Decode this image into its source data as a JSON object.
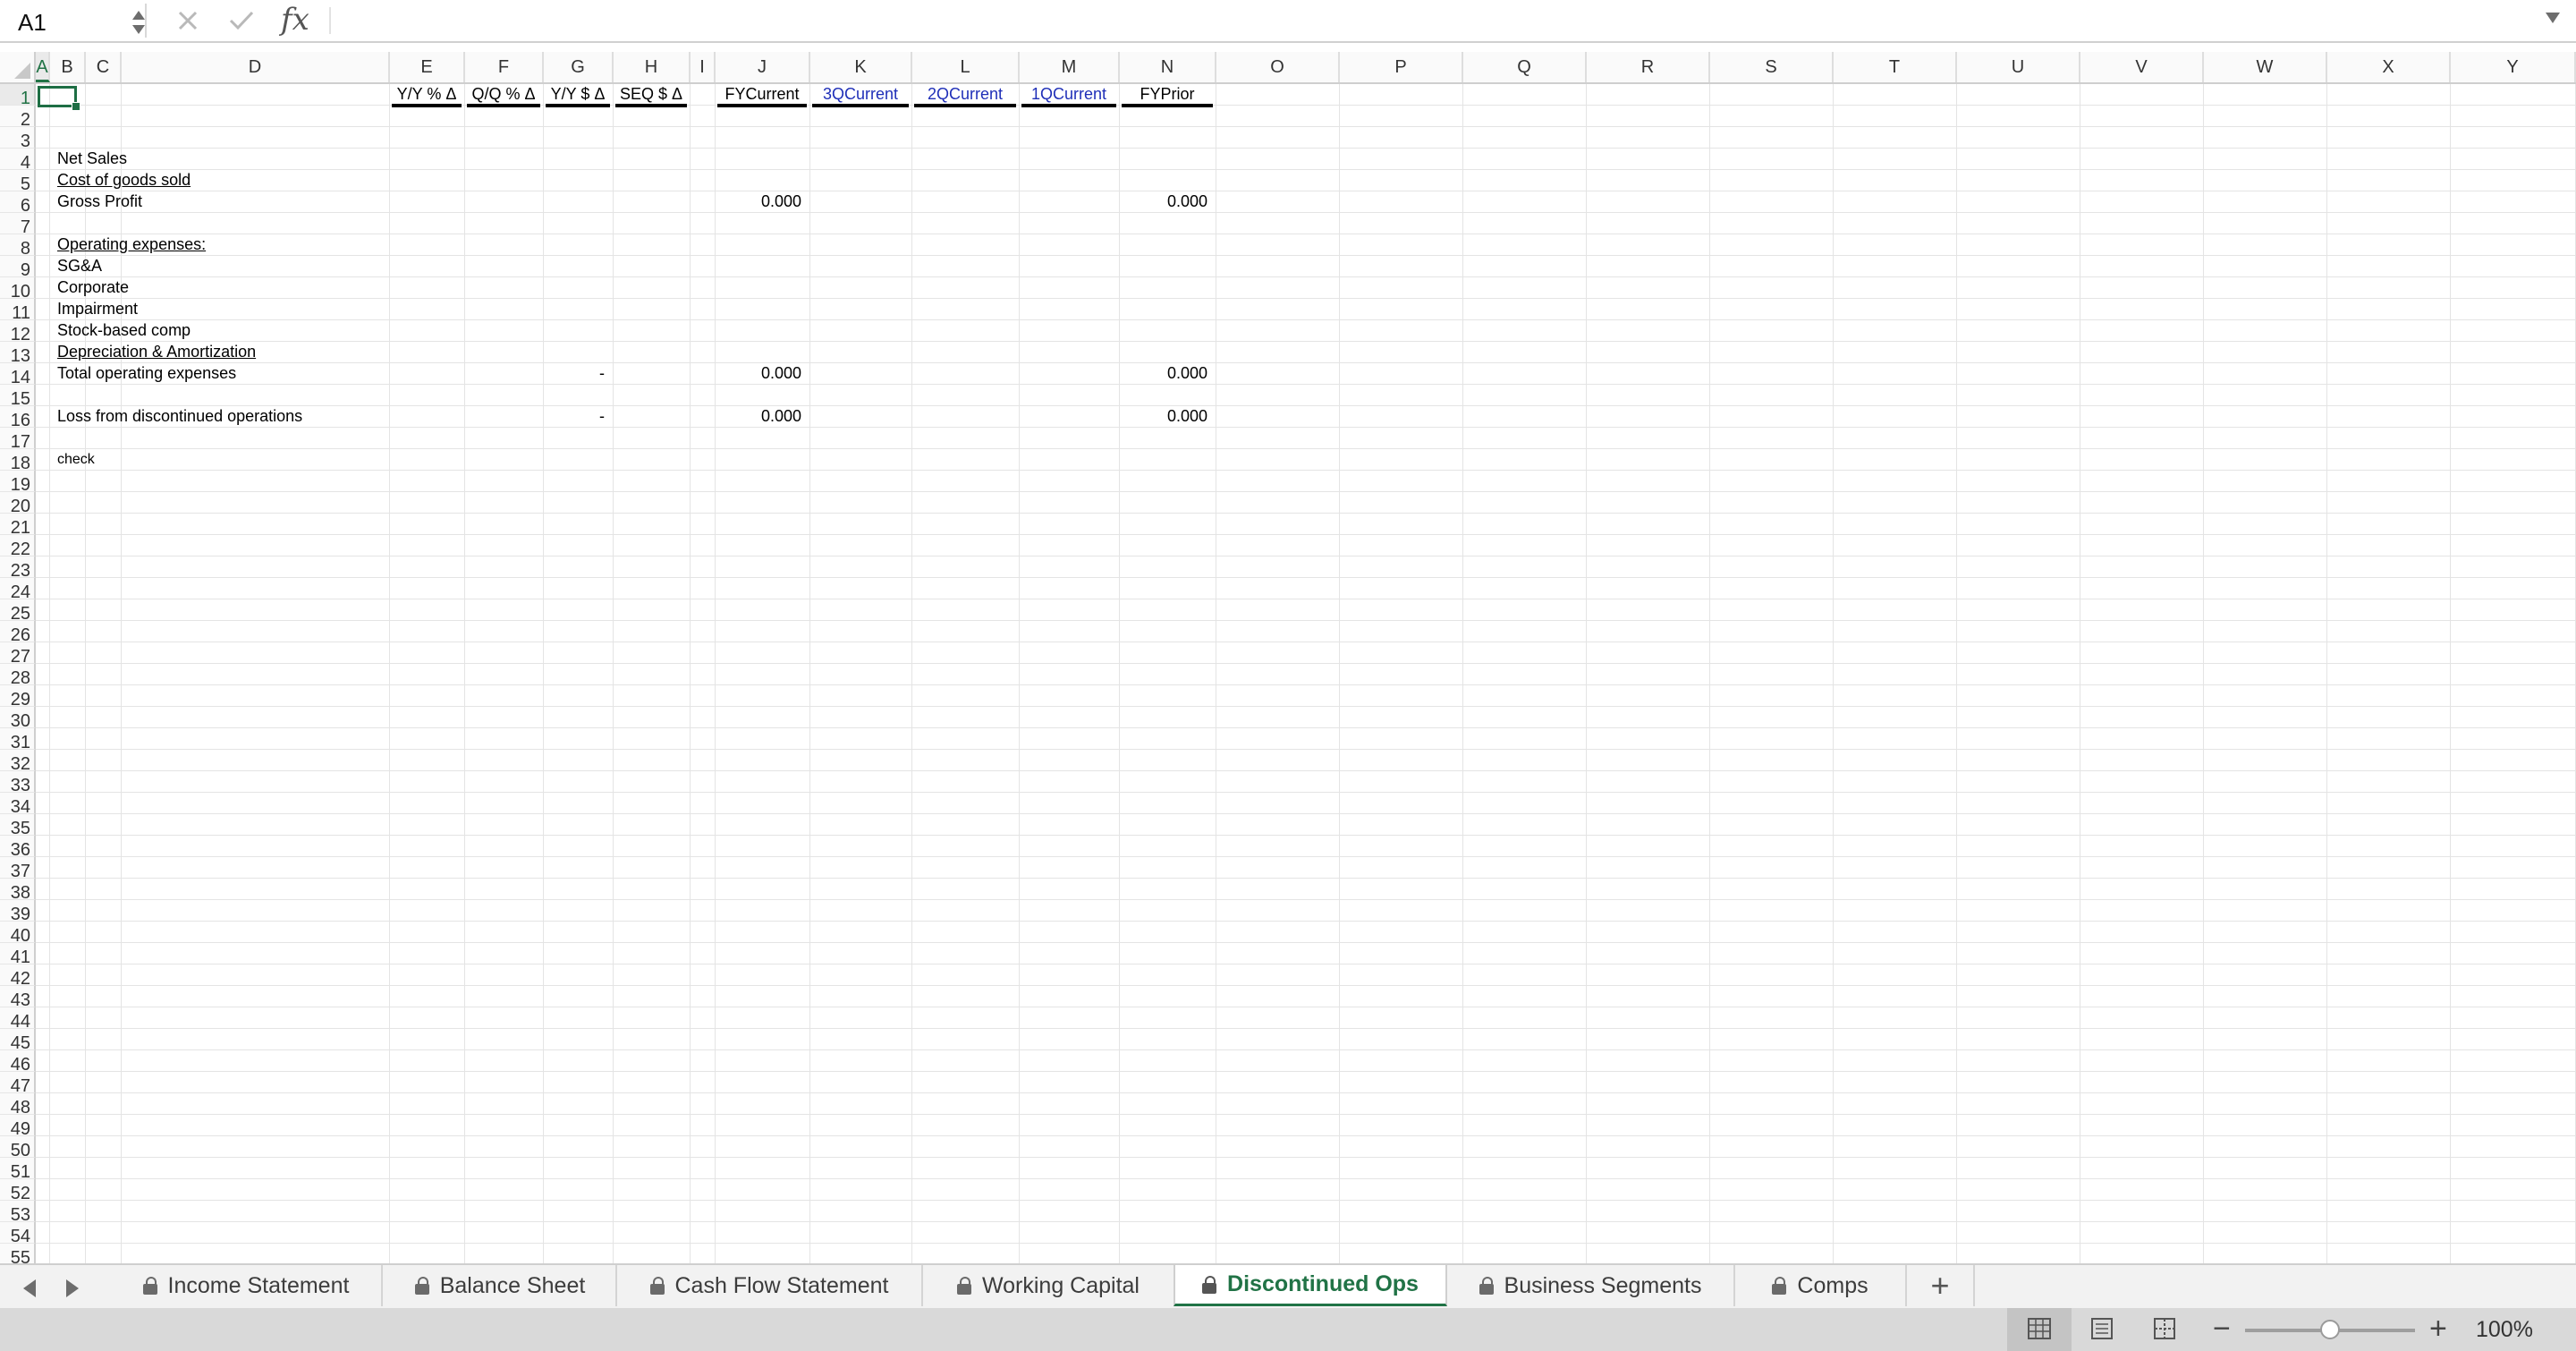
{
  "formula_bar": {
    "name_box": "A1",
    "fx_label": "fx",
    "formula": ""
  },
  "columns": [
    "A",
    "B",
    "C",
    "D",
    "E",
    "F",
    "G",
    "H",
    "I",
    "J",
    "K",
    "L",
    "M",
    "N",
    "O",
    "P",
    "Q",
    "R",
    "S",
    "T",
    "U",
    "V",
    "W",
    "X",
    "Y"
  ],
  "active_cell": {
    "column": "A",
    "row": 1
  },
  "row_count": 55,
  "cells": [
    {
      "ref": "E1",
      "text": "Y/Y % Δ",
      "style": "hdr"
    },
    {
      "ref": "F1",
      "text": "Q/Q % Δ",
      "style": "hdr"
    },
    {
      "ref": "G1",
      "text": "Y/Y $ Δ",
      "style": "hdr"
    },
    {
      "ref": "H1",
      "text": "SEQ $ Δ",
      "style": "hdr"
    },
    {
      "ref": "J1",
      "text": "FYCurrent",
      "style": "hdr"
    },
    {
      "ref": "K1",
      "text": "3QCurrent",
      "style": "hdr blue"
    },
    {
      "ref": "L1",
      "text": "2QCurrent",
      "style": "hdr blue"
    },
    {
      "ref": "M1",
      "text": "1QCurrent",
      "style": "hdr blue"
    },
    {
      "ref": "N1",
      "text": "FYPrior",
      "style": "hdr"
    },
    {
      "ref": "B4",
      "text": "Net Sales",
      "style": ""
    },
    {
      "ref": "B5",
      "text": "Cost of goods sold",
      "style": "ul"
    },
    {
      "ref": "B6",
      "text": "Gross Profit",
      "style": ""
    },
    {
      "ref": "J6",
      "text": "0.000",
      "style": "num"
    },
    {
      "ref": "N6",
      "text": "0.000",
      "style": "num"
    },
    {
      "ref": "B8",
      "text": "Operating expenses:",
      "style": "ul"
    },
    {
      "ref": "B9",
      "text": "SG&A",
      "style": ""
    },
    {
      "ref": "B10",
      "text": "Corporate",
      "style": ""
    },
    {
      "ref": "B11",
      "text": "Impairment",
      "style": ""
    },
    {
      "ref": "B12",
      "text": "Stock-based comp",
      "style": ""
    },
    {
      "ref": "B13",
      "text": "Depreciation & Amortization",
      "style": "ul"
    },
    {
      "ref": "B14",
      "text": "Total operating expenses",
      "style": ""
    },
    {
      "ref": "G14",
      "text": "-",
      "style": "num"
    },
    {
      "ref": "J14",
      "text": "0.000",
      "style": "num"
    },
    {
      "ref": "N14",
      "text": "0.000",
      "style": "num"
    },
    {
      "ref": "B16",
      "text": "Loss from discontinued operations",
      "style": ""
    },
    {
      "ref": "G16",
      "text": "-",
      "style": "num"
    },
    {
      "ref": "J16",
      "text": "0.000",
      "style": "num"
    },
    {
      "ref": "N16",
      "text": "0.000",
      "style": "num"
    },
    {
      "ref": "B18",
      "text": "check",
      "style": "small"
    }
  ],
  "sheet_tabs": [
    {
      "label": "Income Statement",
      "locked": true,
      "active": false
    },
    {
      "label": "Balance Sheet",
      "locked": true,
      "active": false
    },
    {
      "label": "Cash Flow Statement",
      "locked": true,
      "active": false
    },
    {
      "label": "Working Capital",
      "locked": true,
      "active": false
    },
    {
      "label": "Discontinued Ops",
      "locked": true,
      "active": true
    },
    {
      "label": "Business Segments",
      "locked": true,
      "active": false
    },
    {
      "label": "Comps",
      "locked": true,
      "active": false
    }
  ],
  "add_sheet_label": "+",
  "status_bar": {
    "zoom_minus": "−",
    "zoom_plus": "+",
    "zoom_percent": "100%",
    "zoom_level": 1.0
  },
  "colors": {
    "accent_green": "#217346",
    "header_blue": "#1f2fb8",
    "selection_green": "#1e6e44"
  },
  "icons": [
    "cancel-icon",
    "enter-icon",
    "fx-icon",
    "lock-icon",
    "normal-view-icon",
    "page-layout-icon",
    "page-break-icon"
  ]
}
